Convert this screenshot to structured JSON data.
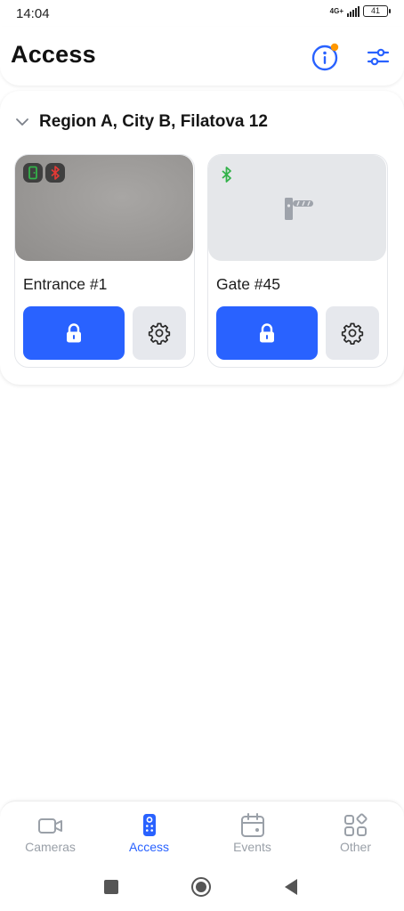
{
  "status_bar": {
    "time": "14:04",
    "network": "4G+",
    "battery": "41"
  },
  "header": {
    "title": "Access"
  },
  "colors": {
    "accent": "#2962ff",
    "notification_dot": "#ff9800",
    "bluetooth_on": "#33b24a",
    "bluetooth_off": "#e53935",
    "door_open": "#33b24a"
  },
  "group": {
    "title": "Region A, City B,  Filatova 12",
    "devices": [
      {
        "name": "Entrance #1",
        "preview": "camera",
        "badges": [
          "door-icon",
          "bluetooth-off-icon"
        ]
      },
      {
        "name": "Gate #45",
        "preview": "barrier-icon",
        "badges": [
          "bluetooth-on-icon"
        ]
      }
    ]
  },
  "bottom_nav": {
    "items": [
      {
        "label": "Cameras",
        "icon": "camera-icon",
        "active": false
      },
      {
        "label": "Access",
        "icon": "remote-icon",
        "active": true
      },
      {
        "label": "Events",
        "icon": "calendar-icon",
        "active": false
      },
      {
        "label": "Other",
        "icon": "grid-icon",
        "active": false
      }
    ]
  }
}
